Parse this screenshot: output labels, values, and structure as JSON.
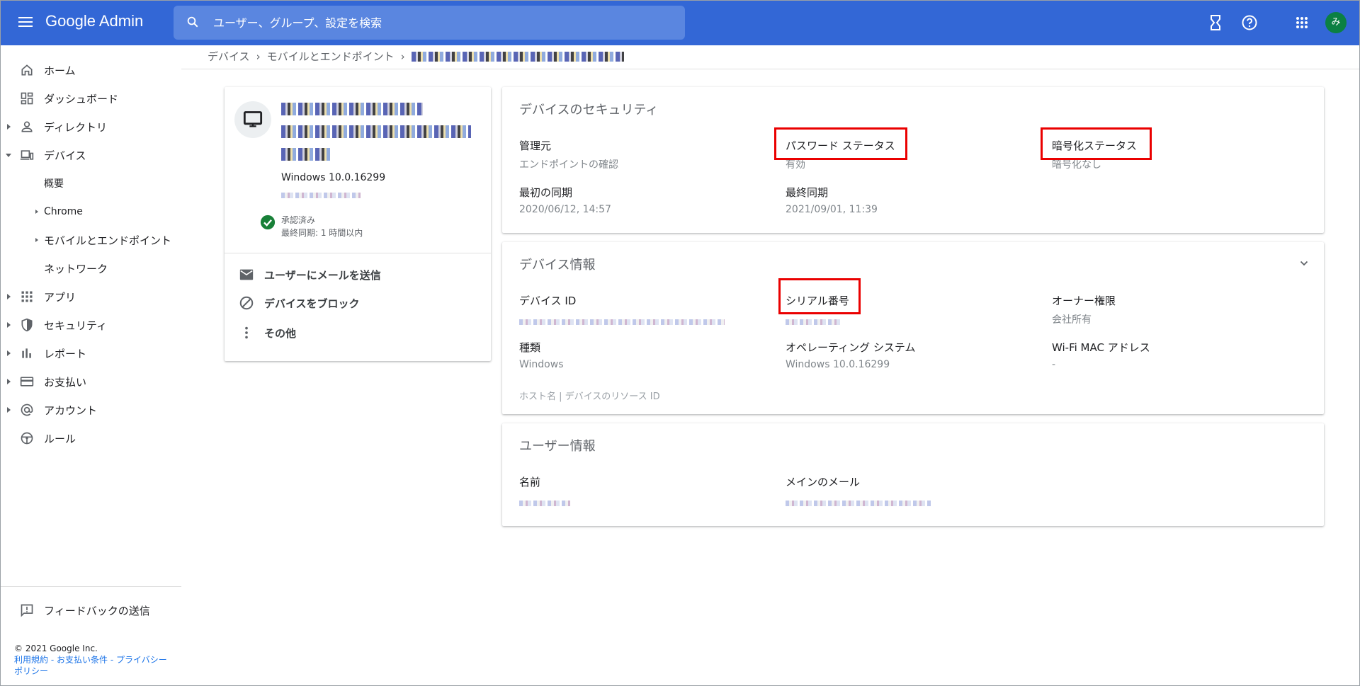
{
  "header": {
    "app_title": "Google Admin",
    "search_placeholder": "ユーザー、グループ、設定を検索",
    "avatar_initial": "み",
    "colors": {
      "bar": "#3367d6",
      "search": "#5a86e0",
      "avatar": "#0b8043"
    }
  },
  "sidebar": {
    "items": [
      {
        "label": "ホーム",
        "icon": "home-icon"
      },
      {
        "label": "ダッシュボード",
        "icon": "dashboard-icon"
      },
      {
        "label": "ディレクトリ",
        "icon": "person-icon"
      },
      {
        "label": "デバイス",
        "icon": "devices-icon"
      },
      {
        "label": "概要"
      },
      {
        "label": "Chrome"
      },
      {
        "label": "モバイルとエンドポイント"
      },
      {
        "label": "ネットワーク"
      },
      {
        "label": "アプリ",
        "icon": "apps-grid-icon"
      },
      {
        "label": "セキュリティ",
        "icon": "shield-icon"
      },
      {
        "label": "レポート",
        "icon": "bar-chart-icon"
      },
      {
        "label": "お支払い",
        "icon": "credit-card-icon"
      },
      {
        "label": "アカウント",
        "icon": "at-sign-icon"
      },
      {
        "label": "ルール",
        "icon": "steering-wheel-icon"
      }
    ],
    "feedback": "フィードバックの送信",
    "copyright": "© 2021 Google Inc.",
    "links": [
      "利用規約",
      "お支払い条件",
      "プライバシー ポリシー"
    ],
    "link_sep": " - "
  },
  "breadcrumb": {
    "items": [
      "デバイス",
      "モバイルとエンドポイント"
    ],
    "separator": "›"
  },
  "device_card": {
    "os": "Windows 10.0.16299",
    "status": "承認済み",
    "last_sync": "最終同期: 1 時間以内",
    "actions": {
      "email": "ユーザーにメールを送信",
      "block": "デバイスをブロック",
      "more": "その他"
    }
  },
  "security": {
    "title": "デバイスのセキュリティ",
    "managed_by_label": "管理元",
    "managed_by_value": "エンドポイントの確認",
    "password_label": "パスワード ステータス",
    "password_value": "有効",
    "encryption_label": "暗号化ステータス",
    "encryption_value": "暗号化なし",
    "first_sync_label": "最初の同期",
    "first_sync_value": "2020/06/12, 14:57",
    "last_sync_label": "最終同期",
    "last_sync_value": "2021/09/01, 11:39"
  },
  "device_info": {
    "title": "デバイス情報",
    "device_id_label": "デバイス ID",
    "serial_label": "シリアル番号",
    "ownership_label": "オーナー権限",
    "ownership_value": "会社所有",
    "type_label": "種類",
    "type_value": "Windows",
    "os_label": "オペレーティング システム",
    "os_value": "Windows 10.0.16299",
    "wifi_label": "Wi-Fi MAC アドレス",
    "wifi_value": "-",
    "host_link": "ホスト名 | デバイスのリソース ID"
  },
  "user_info": {
    "title": "ユーザー情報",
    "name_label": "名前",
    "email_label": "メインのメール"
  },
  "highlight_color": "#ea0000"
}
